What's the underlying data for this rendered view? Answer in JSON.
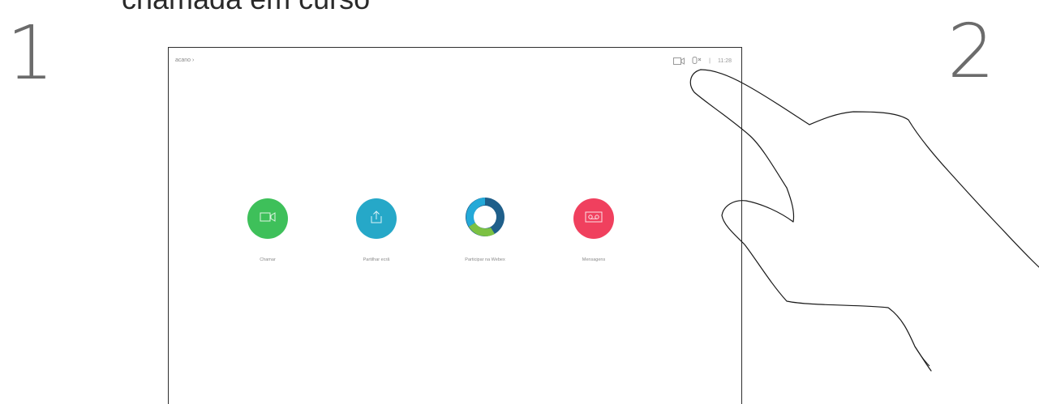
{
  "heading": "chamada em curso",
  "steps": {
    "left": "1",
    "right": "2"
  },
  "topbar": {
    "left_text": "acano",
    "divider": "|",
    "time": "11:28"
  },
  "actions": [
    {
      "label": "Chamar",
      "color": "#3ec05a",
      "icon": "video-camera-icon"
    },
    {
      "label": "Partilhar ecrã",
      "color": "#26a8c8",
      "icon": "share-screen-icon"
    },
    {
      "label": "Participar na Webex",
      "color": "#1f5f8a",
      "icon": "webex-logo-icon"
    },
    {
      "label": "Mensagens",
      "color": "#f0405e",
      "icon": "voicemail-icon"
    }
  ]
}
